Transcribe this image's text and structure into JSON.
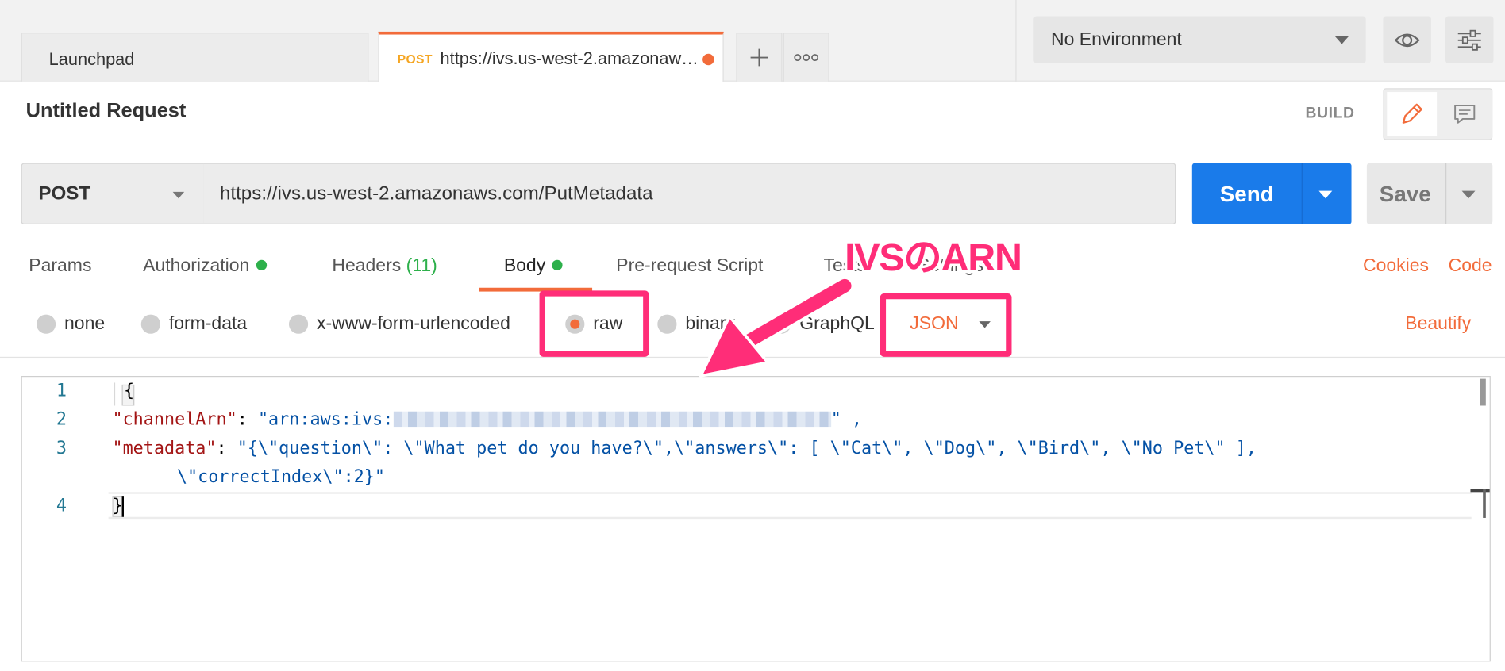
{
  "tabs": {
    "launchpad": "Launchpad",
    "active_method": "POST",
    "active_url": "https://ivs.us-west-2.amazonaws.com/PutMetadata",
    "add_icon": "plus-icon",
    "more_icon": "more-horizontal-icon"
  },
  "environment": {
    "selected": "No Environment",
    "eye_icon": "eye-icon",
    "settings_icon": "sliders-icon"
  },
  "request": {
    "title": "Untitled Request",
    "mode_label": "BUILD",
    "method": "POST",
    "url": "https://ivs.us-west-2.amazonaws.com/PutMetadata",
    "send_label": "Send",
    "save_label": "Save"
  },
  "request_tabs": {
    "params": "Params",
    "authorization": "Authorization",
    "headers": "Headers",
    "headers_count": "(11)",
    "body": "Body",
    "prerequest": "Pre-request Script",
    "tests": "Tests",
    "settings": "Settings",
    "cookies": "Cookies",
    "code": "Code"
  },
  "body_types": {
    "none": "none",
    "form_data": "form-data",
    "urlencoded": "x-www-form-urlencoded",
    "raw": "raw",
    "binary": "binary",
    "graphql": "GraphQL",
    "language": "JSON",
    "beautify": "Beautify",
    "selected": "raw"
  },
  "editor": {
    "line_numbers": [
      "1",
      "2",
      "3",
      "4"
    ],
    "line1": "{",
    "line2_key": "\"channelArn\"",
    "line2_colon": ": ",
    "line2_value_prefix": "\"arn:aws:ivs:",
    "line2_value_suffix": "\" ,",
    "line3_key": "\"metadata\"",
    "line3_colon": ": ",
    "line3_value_a": "\"{\\\"question\\\": \\\"What pet do you have?\\\",\\\"answers\\\": [ \\\"Cat\\\", \\\"Dog\\\", \\\"Bird\\\", \\\"No Pet\\\" ],",
    "line3_value_b": "    \\\"correctIndex\\\":2}\"",
    "line4": "}"
  },
  "annotation": {
    "label": "IVSのARN",
    "color": "#ff2d78"
  },
  "colors": {
    "accent": "#f26b3a",
    "send": "#1a7bea",
    "status_green": "#2db04b"
  }
}
